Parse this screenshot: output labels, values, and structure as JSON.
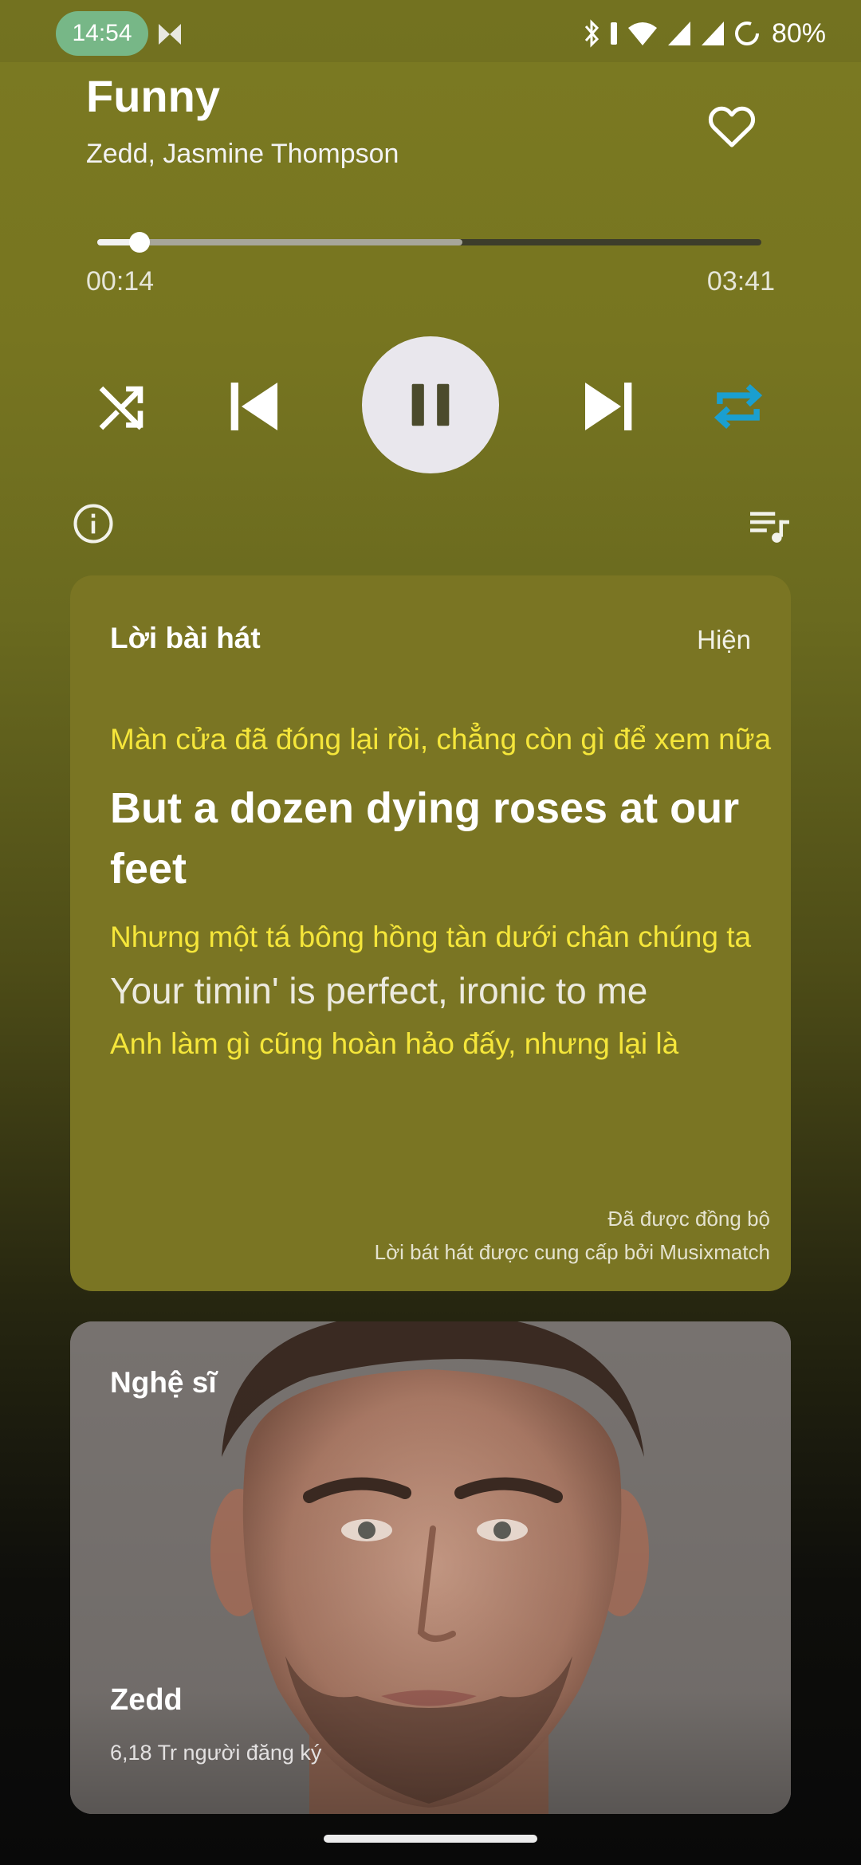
{
  "status_bar": {
    "time": "14:54",
    "battery_percent": "80%",
    "icons": [
      "bluetooth-icon",
      "wifi-icon",
      "cell-signal-icon",
      "cell-signal-icon",
      "battery-saver-icon"
    ]
  },
  "now_playing": {
    "title": "Funny",
    "artists": "Zedd, Jasmine Thompson",
    "favorite_icon": "heart-outline-icon",
    "current_time": "00:14",
    "total_time": "03:41",
    "progress_fraction": 0.0633,
    "buffered_fraction": 0.55
  },
  "controls": {
    "shuffle_icon": "shuffle-icon",
    "previous_icon": "skip-previous-icon",
    "play_pause_icon": "pause-icon",
    "next_icon": "skip-next-icon",
    "repeat_icon": "repeat-icon",
    "repeat_active_color": "#1a9fd0",
    "info_icon": "info-icon",
    "queue_icon": "queue-music-icon"
  },
  "lyrics": {
    "heading": "Lời bài hát",
    "toggle_label": "Hiện",
    "lines": [
      {
        "kind": "translation",
        "text": "Màn cửa đã đóng lại rồi, chẳng còn gì để xem nữa"
      },
      {
        "kind": "active",
        "text": "But a dozen dying roses at our feet"
      },
      {
        "kind": "translation",
        "text": "Nhưng một tá bông hồng tàn dưới chân chúng ta"
      },
      {
        "kind": "next",
        "text": "Your timin' is perfect, ironic to me"
      },
      {
        "kind": "translation",
        "text": "Anh làm gì cũng hoàn hảo đấy, nhưng lại là"
      }
    ],
    "sync_status": "Đã được đồng bộ",
    "provider": "Lời bát hát được cung cấp bởi Musixmatch"
  },
  "artist": {
    "heading": "Nghệ sĩ",
    "name": "Zedd",
    "subscribers": "6,18 Tr người đăng ký"
  },
  "colors": {
    "lyrics_translation": "#f5e63a",
    "accent_blue": "#1a9fd0",
    "play_button_bg": "#e9e7ed"
  }
}
